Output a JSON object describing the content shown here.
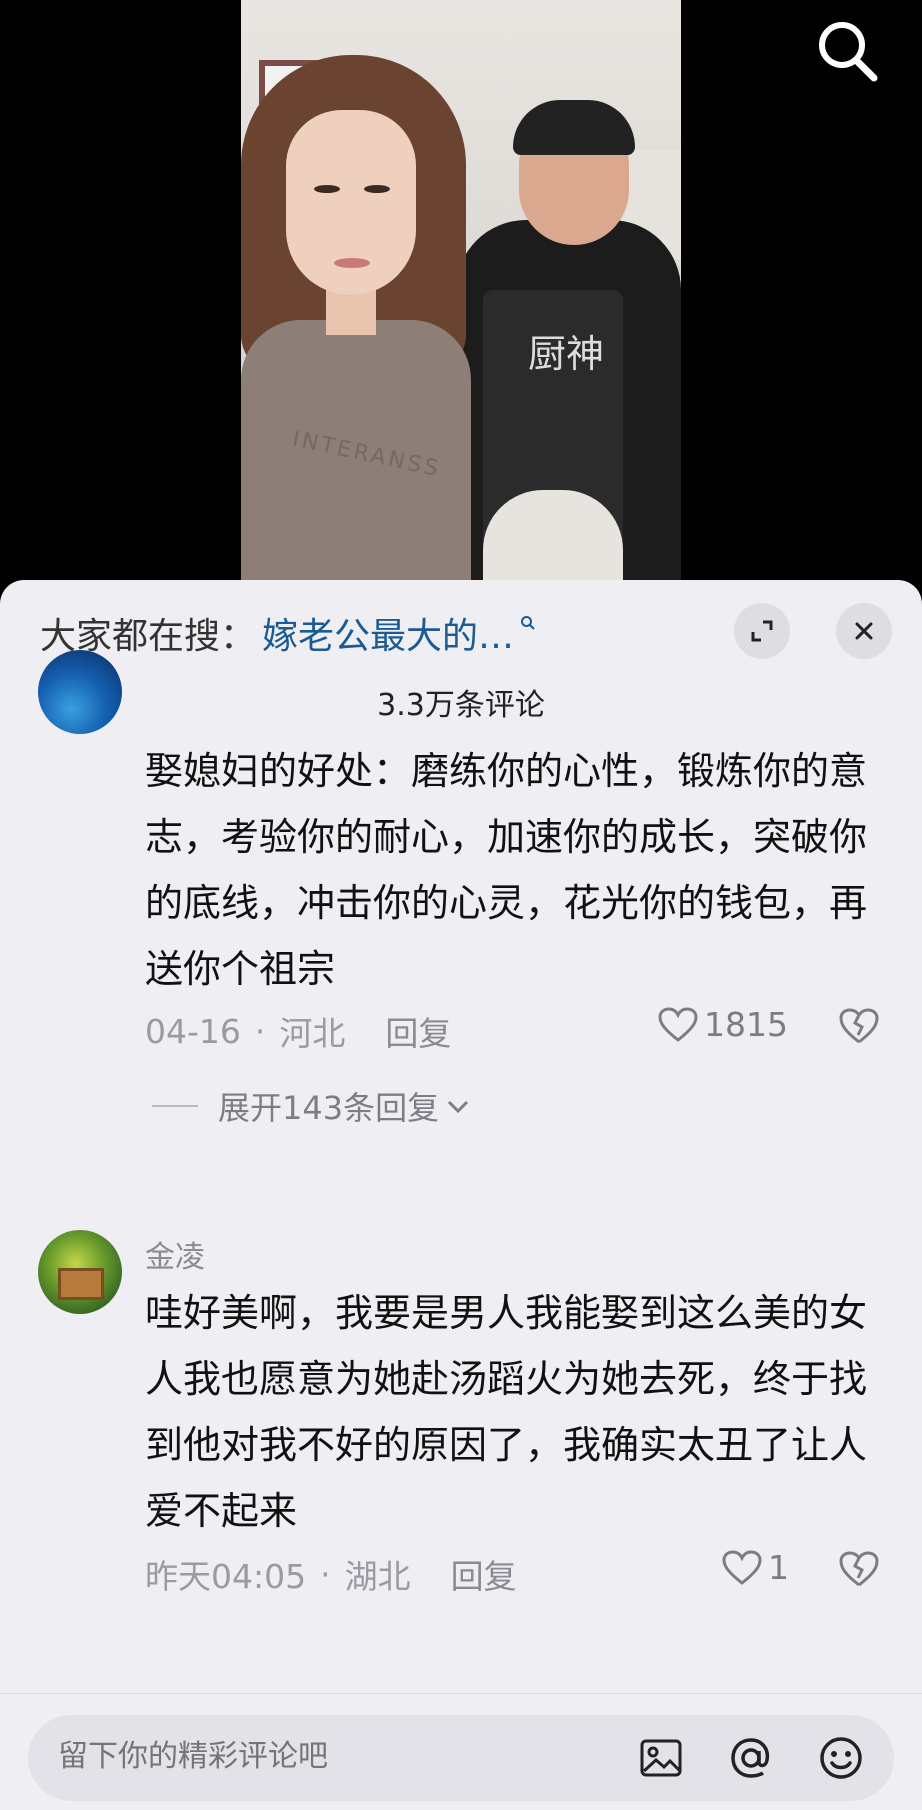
{
  "header": {
    "search_icon": "search-icon"
  },
  "video": {
    "sweater_text": "INTERANSS",
    "apron_text": "厨神"
  },
  "sheet": {
    "hot_search_prefix": "大家都在搜：",
    "hot_search_term": "嫁老公最大的…",
    "comment_count": "3.3万条评论",
    "icons": {
      "expand": "expand-icon",
      "close": "close-icon"
    }
  },
  "comments": [
    {
      "text": "娶媳妇的好处：磨练你的心性，锻炼你的意志，考验你的耐心，加速你的成长，突破你的底线，冲击你的心灵，花光你的钱包，再送你个祖宗",
      "date": "04-16",
      "location": "河北",
      "reply_label": "回复",
      "likes": "1815",
      "expand_replies": "展开143条回复"
    },
    {
      "username": "金凌",
      "text": "哇好美啊，我要是男人我能娶到这么美的女人我也愿意为她赴汤蹈火为她去死，终于找到他对我不好的原因了，我确实太丑了让人爱不起来",
      "date": "昨天04:05",
      "location": "湖北",
      "reply_label": "回复",
      "likes": "1"
    }
  ],
  "input_bar": {
    "placeholder": "留下你的精彩评论吧",
    "icons": [
      "image-icon",
      "at-icon",
      "emoji-icon"
    ]
  }
}
